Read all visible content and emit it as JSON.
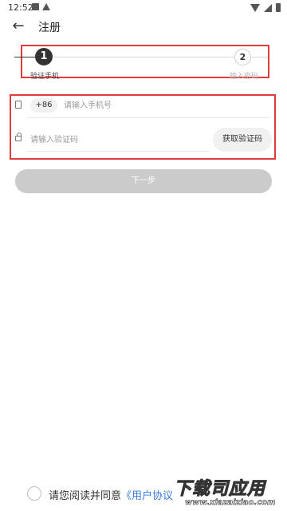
{
  "status_bar": {
    "time": "12:52"
  },
  "header": {
    "back_icon": "arrow-left-icon",
    "title": "注册"
  },
  "stepper": {
    "steps": [
      {
        "number": "1",
        "label": "验证手机",
        "active": true
      },
      {
        "number": "2",
        "label": "输入密码",
        "active": false
      }
    ]
  },
  "form": {
    "country_code": "+86",
    "phone_placeholder": "请输入手机号",
    "code_placeholder": "请输入验证码",
    "get_code_label": "获取验证码"
  },
  "next_button": {
    "label": "下一步"
  },
  "agreement": {
    "text": "请您阅读并同意",
    "link": "《用户协议"
  },
  "watermark": {
    "main": "下载司应用",
    "sub": "www.xiazaiziao.com"
  },
  "colors": {
    "highlight_frame": "#e23b3b",
    "link": "#3a7be0",
    "disabled_button": "#cbcbcb"
  }
}
